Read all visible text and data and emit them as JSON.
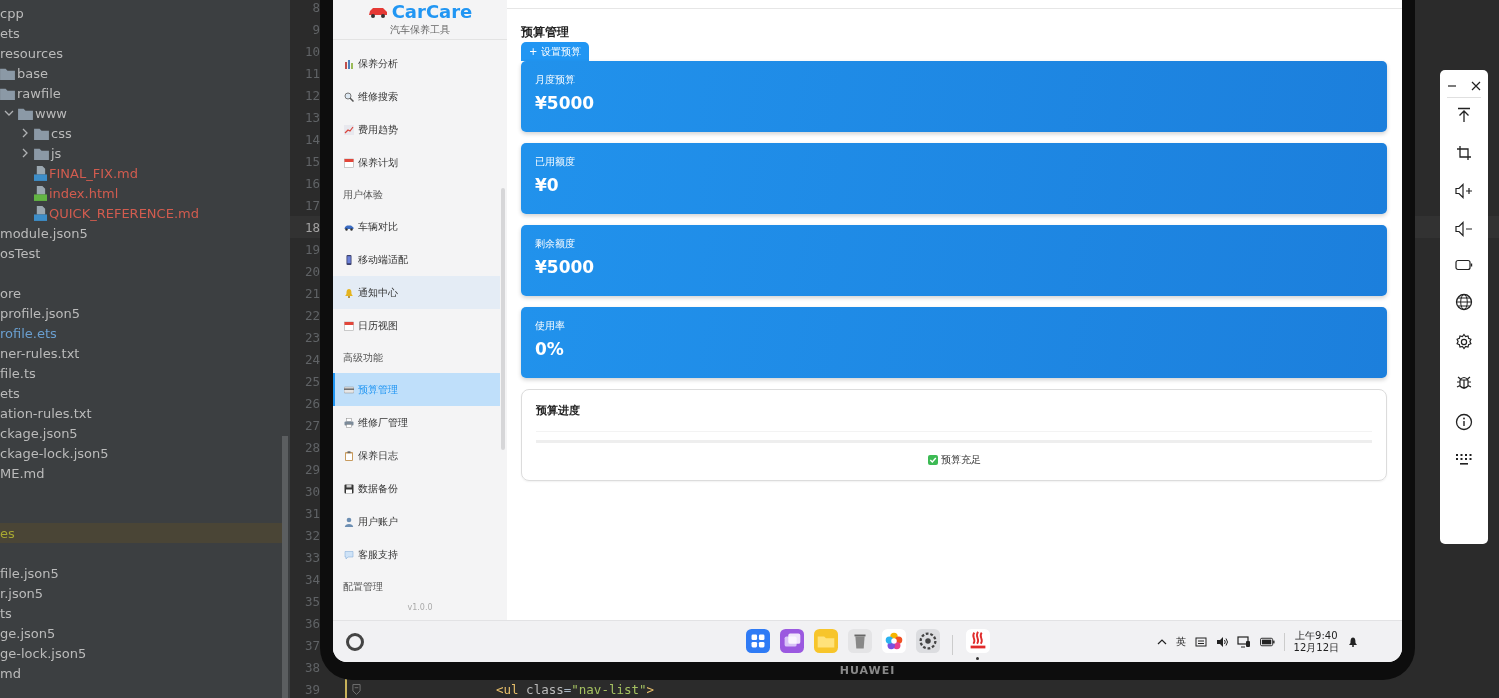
{
  "file_tree_sections": [
    [
      {
        "label": "cpp",
        "selected": false
      },
      {
        "label": "ets",
        "selected": false
      },
      {
        "label": "resources",
        "selected": false,
        "children": [
          {
            "label": "base",
            "kind": "folder",
            "selected": false
          },
          {
            "label": "rawfile",
            "kind": "folder",
            "selected": false,
            "children": [
              {
                "label": "www",
                "kind": "folder",
                "expanded": true,
                "selected": false,
                "children": [
                  {
                    "label": "css",
                    "kind": "folder",
                    "expanded": false,
                    "selected": false
                  },
                  {
                    "label": "js",
                    "kind": "folder",
                    "expanded": false,
                    "selected": false
                  },
                  {
                    "label": "FINAL_FIX.md",
                    "kind": "markdown",
                    "color": "#d25c4f",
                    "selected": false
                  },
                  {
                    "label": "index.html",
                    "kind": "html",
                    "color": "#d25c4f",
                    "selected": false
                  },
                  {
                    "label": "QUICK_REFERENCE.md",
                    "kind": "markdown",
                    "color": "#d25c4f",
                    "selected": false
                  }
                ]
              }
            ]
          }
        ]
      },
      {
        "label": "module.json5",
        "selected": false
      },
      {
        "label": "osTest",
        "selected": false
      }
    ],
    [
      {
        "label": "ore",
        "selected": false
      },
      {
        "label": "profile.json5",
        "selected": false
      },
      {
        "label": "rofile.ets",
        "color": "#6a9fd0",
        "selected": false
      },
      {
        "label": "ner-rules.txt",
        "selected": false
      },
      {
        "label": "file.ts",
        "selected": false
      },
      {
        "label": "ets",
        "selected": false
      },
      {
        "label": "ation-rules.txt",
        "selected": false
      },
      {
        "label": "ckage.json5",
        "selected": false
      },
      {
        "label": "ckage-lock.json5",
        "selected": false
      },
      {
        "label": "ME.md",
        "selected": false
      }
    ],
    [
      {
        "label": "es",
        "color": "#a8a832",
        "selected": true
      }
    ],
    [
      {
        "label": "file.json5",
        "selected": false
      },
      {
        "label": "r.json5",
        "selected": false
      },
      {
        "label": "ts",
        "selected": false
      },
      {
        "label": "ge.json5",
        "selected": false
      },
      {
        "label": "ge-lock.json5",
        "selected": false
      },
      {
        "label": "md",
        "selected": false
      }
    ]
  ],
  "editor": {
    "lines": [
      {
        "number": "8",
        "current": false
      },
      {
        "number": "9",
        "current": false
      },
      {
        "number": "10",
        "current": false
      },
      {
        "number": "11",
        "current": false
      },
      {
        "number": "12",
        "current": false
      },
      {
        "number": "13",
        "current": false
      },
      {
        "number": "14",
        "current": false
      },
      {
        "number": "15",
        "current": false
      },
      {
        "number": "16",
        "current": false
      },
      {
        "number": "17",
        "current": false
      },
      {
        "number": "18",
        "current": true
      },
      {
        "number": "19",
        "current": false
      },
      {
        "number": "20",
        "current": false
      },
      {
        "number": "21",
        "current": false
      },
      {
        "number": "22",
        "current": false
      },
      {
        "number": "23",
        "current": false
      },
      {
        "number": "24",
        "current": false
      },
      {
        "number": "25",
        "current": false
      },
      {
        "number": "26",
        "current": false
      },
      {
        "number": "27",
        "current": false
      },
      {
        "number": "28",
        "current": false
      },
      {
        "number": "29",
        "current": false
      },
      {
        "number": "30",
        "current": false
      },
      {
        "number": "31",
        "current": false
      },
      {
        "number": "32",
        "current": false
      },
      {
        "number": "33",
        "current": false
      },
      {
        "number": "34",
        "current": false
      },
      {
        "number": "35",
        "current": false
      },
      {
        "number": "36",
        "current": false
      },
      {
        "number": "37",
        "current": false
      },
      {
        "number": "38",
        "current": false
      },
      {
        "number": "39",
        "current": false,
        "code": [
          {
            "text": "<ul ",
            "kind": "tag"
          },
          {
            "text": "class",
            "kind": "attr"
          },
          {
            "text": "=",
            "kind": "plain"
          },
          {
            "text": "\"nav-list\"",
            "kind": "value"
          },
          {
            "text": ">",
            "kind": "tag"
          }
        ]
      }
    ]
  },
  "app": {
    "logo": "CarCare",
    "subtitle": "汽车保养工具",
    "sidebar_sections": [
      {
        "items": [
          {
            "label": "保养分析",
            "selected": false,
            "hovered": false
          },
          {
            "label": "维修搜索",
            "selected": false,
            "hovered": false
          },
          {
            "label": "费用趋势",
            "selected": false,
            "hovered": false
          },
          {
            "label": "保养计划",
            "selected": false,
            "hovered": false
          }
        ]
      },
      {
        "label": "用户体验",
        "items": [
          {
            "label": "车辆对比",
            "selected": false,
            "hovered": false
          },
          {
            "label": "移动端适配",
            "selected": false,
            "hovered": false
          },
          {
            "label": "通知中心",
            "selected": false,
            "hovered": true
          },
          {
            "label": "日历视图",
            "selected": false,
            "hovered": false
          }
        ]
      },
      {
        "label": "高级功能",
        "items": [
          {
            "label": "预算管理",
            "selected": true,
            "hovered": false
          },
          {
            "label": "维修厂管理",
            "selected": false,
            "hovered": false
          },
          {
            "label": "保养日志",
            "selected": false,
            "hovered": false
          },
          {
            "label": "数据备份",
            "selected": false,
            "hovered": false
          },
          {
            "label": "用户账户",
            "selected": false,
            "hovered": false
          },
          {
            "label": "客服支持",
            "selected": false,
            "hovered": false
          }
        ]
      },
      {
        "label": "配置管理"
      }
    ],
    "version": "v1.0.0",
    "page_title": "预算管理",
    "add_button": "+ 设置预算",
    "stat_cards": [
      {
        "label": "月度预算",
        "value": "¥5000"
      },
      {
        "label": "已用额度",
        "value": "¥0"
      },
      {
        "label": "剩余额度",
        "value": "¥5000"
      },
      {
        "label": "使用率",
        "value": "0%"
      }
    ],
    "progress_panel": {
      "title": "预算进度",
      "level": 0,
      "status": "预算充足",
      "ok": true
    }
  },
  "taskbar": {
    "dock": [
      {
        "running": false
      },
      {
        "running": false
      },
      {
        "running": false
      },
      {
        "running": false
      },
      {
        "running": false
      },
      {
        "running": false
      },
      {
        "running": true
      }
    ],
    "ime": "英",
    "time": "上午9:40",
    "date": "12月12日"
  },
  "device_brand": "HUAWEI"
}
